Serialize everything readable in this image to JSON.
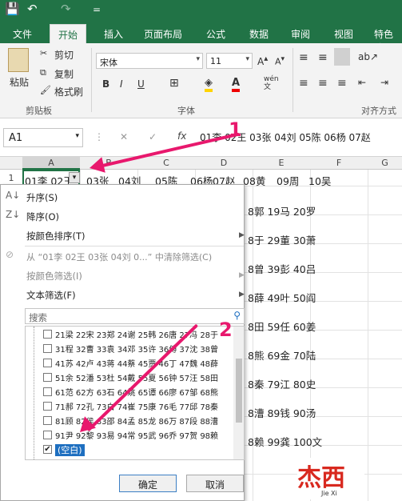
{
  "titlebar": {
    "save_icon": "💾",
    "undo_icon": "↶",
    "redo_icon": "↷",
    "qat_more": "="
  },
  "tabs": [
    "文件",
    "开始",
    "插入",
    "页面布局",
    "公式",
    "数据",
    "审阅",
    "视图",
    "特色功"
  ],
  "ribbon": {
    "paste": "粘贴",
    "cut": "剪切",
    "copy": "复制",
    "format_painter": "格式刷",
    "clipboard": "剪贴板",
    "font_name": "宋体",
    "font_size": "11",
    "font_group": "字体",
    "bold": "B",
    "italic": "I",
    "underline": "U",
    "wen": "wén",
    "align_group": "对齐方式"
  },
  "formula_bar": {
    "name_box": "A1",
    "cancel": "✕",
    "enter": "✓",
    "fx": "fx",
    "formula": "01李 02王 03张 04刘 05陈 06杨 07赵"
  },
  "columns": [
    "A",
    "B",
    "C",
    "D",
    "E",
    "F",
    "G"
  ],
  "rows": [
    {
      "no": "1",
      "cells": [
        "01李",
        "02王",
        "03张",
        "04刘",
        "05陈",
        "06杨",
        "07赵",
        "08黄",
        "09周",
        "10吴"
      ]
    },
    {
      "tail": [
        "8郭",
        "19马",
        "20罗"
      ]
    },
    {
      "tail": [
        "8于",
        "29董",
        "30萧"
      ]
    },
    {
      "tail": [
        "8曾",
        "39彭",
        "40吕"
      ]
    },
    {
      "tail": [
        "8薛",
        "49叶",
        "50阎"
      ]
    },
    {
      "tail": [
        "8田",
        "59任",
        "60姜"
      ]
    },
    {
      "tail": [
        "8熊",
        "69金",
        "70陆"
      ]
    },
    {
      "tail": [
        "8秦",
        "79江",
        "80史"
      ]
    },
    {
      "tail": [
        "8漕",
        "89钱",
        "90汤"
      ]
    },
    {
      "tail": [
        "8赖",
        "99龚",
        "100文"
      ]
    }
  ],
  "menu": {
    "sort_asc": "升序(S)",
    "sort_desc": "降序(O)",
    "sort_color": "按颜色排序(T)",
    "clear_filter": "从 “01李 02王 03张 04刘 0...” 中清除筛选(C)",
    "filter_color": "按颜色筛选(I)",
    "text_filter": "文本筛选(F)",
    "search_placeholder": "搜索",
    "items": [
      "21梁 22宋 23郑 24谢 25韩 26唐 27冯 28于",
      "31程 32曹 33袁 34邓 35许 36傅 37沈 38曾",
      "41苏 42卢 43蒋 44蔡 45贾 46丁 47魏 48薛",
      "51余 52潘 53杜 54戴 55夏 56钟 57汪 58田",
      "61范 62方 63石 64姚 65谭 66廖 67邹 68熊",
      "71郝 72孔 73白 74崔 75康 76毛 77邱 78秦",
      "81顾 82侯 83邵 84孟 85龙 86万 87段 88漕",
      "91尹 92黎 93易 94常 95武 96乔 97贺 98赖"
    ],
    "blank": "(空白)",
    "ok": "确定",
    "cancel": "取消"
  },
  "annotations": {
    "n1": "1",
    "n2": "2"
  },
  "watermark": {
    "brand": "杰西",
    "sub": "Jie Xi"
  },
  "colors": {
    "excel_green": "#217346",
    "arrow": "#e8186d"
  }
}
